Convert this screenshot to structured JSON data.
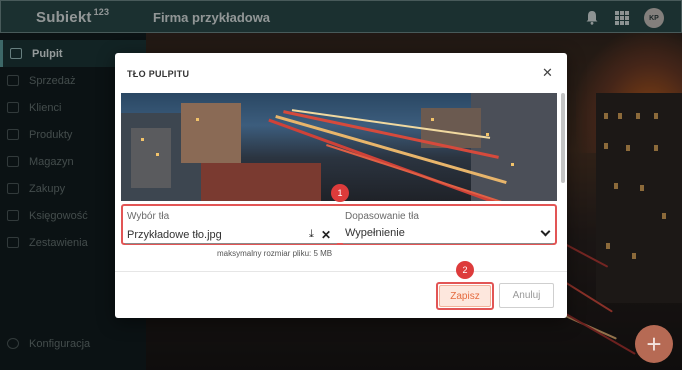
{
  "app": {
    "brand": "Subiekt",
    "brand_sup": "123",
    "company": "Firma przykładowa",
    "avatar_initials": "KP"
  },
  "sidebar": {
    "items": [
      {
        "label": "Pulpit",
        "icon": "desktop-icon",
        "active": true
      },
      {
        "label": "Sprzedaż",
        "icon": "receipt-icon"
      },
      {
        "label": "Klienci",
        "icon": "users-icon"
      },
      {
        "label": "Produkty",
        "icon": "box-icon"
      },
      {
        "label": "Magazyn",
        "icon": "warehouse-icon"
      },
      {
        "label": "Zakupy",
        "icon": "cart-icon"
      },
      {
        "label": "Księgowość",
        "icon": "ledger-icon"
      },
      {
        "label": "Zestawienia",
        "icon": "report-icon"
      }
    ],
    "config_label": "Konfiguracja"
  },
  "dialog": {
    "title": "TŁO PULPITU",
    "background_field": {
      "label": "Wybór tła",
      "value": "Przykładowe tło.jpg"
    },
    "fit_field": {
      "label": "Dopasowanie tła",
      "value": "Wypełnienie"
    },
    "hint": "maksymalny rozmiar pliku: 5 MB",
    "save_label": "Zapisz",
    "cancel_label": "Anuluj",
    "badge1": "1",
    "badge2": "2"
  },
  "fab_symbol": "+",
  "colors": {
    "topbar": "#2a4a4b",
    "accent": "#e56b3f",
    "highlight": "#e25555"
  }
}
